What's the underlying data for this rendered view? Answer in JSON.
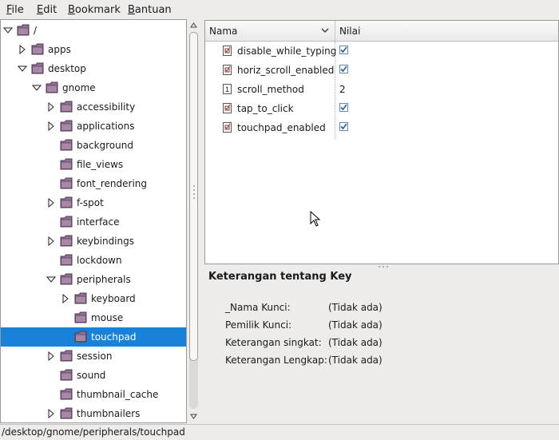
{
  "menubar": {
    "items": [
      {
        "label": "File",
        "mnemonic": "F"
      },
      {
        "label": "Edit",
        "mnemonic": "E"
      },
      {
        "label": "Bookmark",
        "mnemonic": "B"
      },
      {
        "label": "Bantuan",
        "mnemonic": "B"
      }
    ]
  },
  "tree": {
    "selected_color": "#1982d8",
    "items": [
      {
        "label": "/",
        "state": "expanded"
      },
      {
        "label": "apps",
        "state": "collapsed"
      },
      {
        "label": "desktop",
        "state": "expanded"
      },
      {
        "label": "gnome",
        "state": "expanded"
      },
      {
        "label": "accessibility",
        "state": "collapsed"
      },
      {
        "label": "applications",
        "state": "collapsed"
      },
      {
        "label": "background",
        "state": "leaf"
      },
      {
        "label": "file_views",
        "state": "leaf"
      },
      {
        "label": "font_rendering",
        "state": "leaf"
      },
      {
        "label": "f-spot",
        "state": "collapsed"
      },
      {
        "label": "interface",
        "state": "leaf"
      },
      {
        "label": "keybindings",
        "state": "collapsed"
      },
      {
        "label": "lockdown",
        "state": "leaf"
      },
      {
        "label": "peripherals",
        "state": "expanded"
      },
      {
        "label": "keyboard",
        "state": "collapsed"
      },
      {
        "label": "mouse",
        "state": "leaf"
      },
      {
        "label": "touchpad",
        "state": "leaf",
        "selected": true
      },
      {
        "label": "session",
        "state": "collapsed"
      },
      {
        "label": "sound",
        "state": "leaf"
      },
      {
        "label": "thumbnail_cache",
        "state": "leaf"
      },
      {
        "label": "thumbnailers",
        "state": "collapsed"
      }
    ]
  },
  "table": {
    "col_name": "Nama",
    "col_value": "Nilai",
    "rows": [
      {
        "name": "disable_while_typing",
        "type": "bool",
        "value": true
      },
      {
        "name": "horiz_scroll_enabled",
        "type": "bool",
        "value": true
      },
      {
        "name": "scroll_method",
        "type": "int",
        "value": "2"
      },
      {
        "name": "tap_to_click",
        "type": "bool",
        "value": true
      },
      {
        "name": "touchpad_enabled",
        "type": "bool",
        "value": true
      }
    ]
  },
  "details": {
    "title": "Keterangan tentang Key",
    "rows": [
      {
        "label": "_Nama Kunci:",
        "value": "(Tidak ada)"
      },
      {
        "label": "Pemilik Kunci:",
        "value": "(Tidak ada)"
      },
      {
        "label": "Keterangan singkat:",
        "value": "(Tidak ada)"
      },
      {
        "label": "Keterangan Lengkap:",
        "value": "(Tidak ada)"
      }
    ]
  },
  "statusbar": {
    "path": "/desktop/gnome/peripherals/touchpad"
  }
}
